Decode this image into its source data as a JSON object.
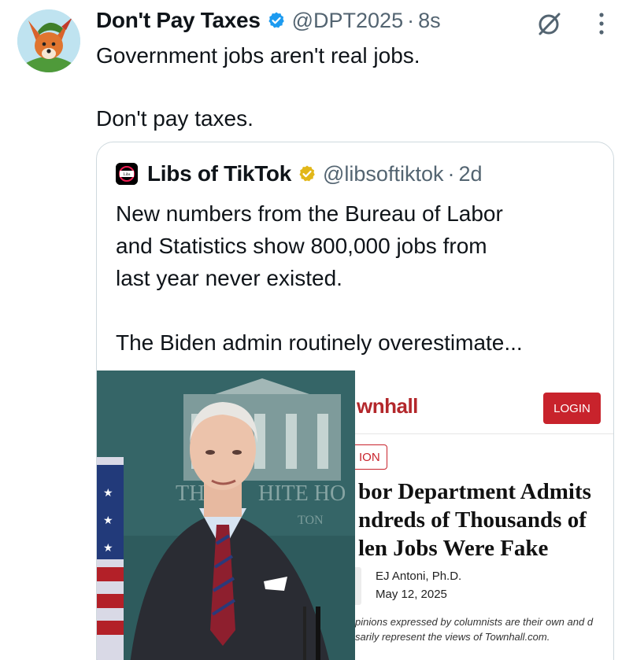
{
  "post": {
    "author_name": "Don't Pay Taxes",
    "handle": "@DPT2025",
    "separator": "·",
    "time": "8s",
    "text": "Government jobs aren't real jobs.\n\nDon't pay taxes.",
    "icons": {
      "avatar": "fox-avatar",
      "verified": "verified-badge-blue",
      "grok": "grok-icon",
      "more": "more-vertical-icon"
    }
  },
  "quoted_post": {
    "author_name": "Libs of TikTok",
    "handle": "@libsoftiktok",
    "separator": "·",
    "time": "2d",
    "text": "New numbers from the Bureau of Labor\nand Statistics show 800,000 jobs from\nlast year never existed.\n\nThe Biden admin routinely overestimate...",
    "icons": {
      "avatar": "libs-of-tiktok-logo",
      "verified": "verified-badge-gold"
    }
  },
  "media": {
    "photo": {
      "sign_text_1": "TH",
      "sign_text_2": "HITE HO",
      "sign_text_3": "TON"
    },
    "article": {
      "site_logo": "wnhall",
      "login_label": "LOGIN",
      "tag": "ION",
      "headline": "bor Department Admits\nndreds of Thousands of\nlen Jobs Were Fake",
      "author": "EJ Antoni, Ph.D.",
      "date": "May 12, 2025",
      "disclaimer": "pinions expressed by columnists are their own and d\nsarily represent the views of Townhall.com."
    }
  },
  "colors": {
    "text_primary": "#0f1419",
    "text_secondary": "#536471",
    "verified_blue": "#1d9bf0",
    "verified_gold": "#e2b719",
    "border": "#cfd9de",
    "townhall_red": "#c8232c"
  }
}
